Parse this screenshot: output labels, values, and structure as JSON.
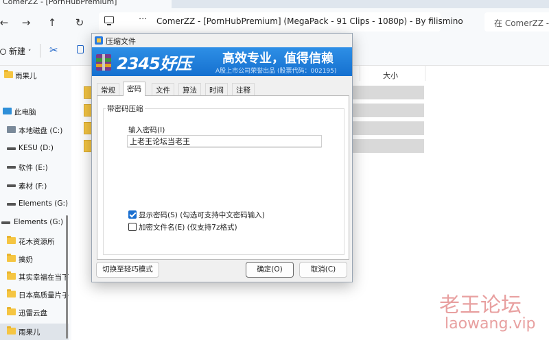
{
  "explorer": {
    "tab_title": "ComerZZ - [PornHubPremium]",
    "address_path": "ComerZZ - [PornHubPremium] (MegaPack - 91 Clips - 1080p) - By filismino",
    "address_more": "···",
    "search_placeholder": "在 ComerZZ - [P",
    "toolbar": {
      "new_label": "新建"
    },
    "column_size": "大小",
    "sidebar": [
      {
        "label": "雨果儿",
        "kind": "folder"
      },
      {
        "label": "此电脑",
        "kind": "pc"
      },
      {
        "label": "本地磁盘 (C:)",
        "kind": "local"
      },
      {
        "label": "KESU (D:)",
        "kind": "drive"
      },
      {
        "label": "软件 (E:)",
        "kind": "drive"
      },
      {
        "label": "素材 (F:)",
        "kind": "drive"
      },
      {
        "label": "Elements (G:)",
        "kind": "drive"
      },
      {
        "label": "Elements (G:)",
        "kind": "drive"
      },
      {
        "label": "花木资源所",
        "kind": "folder"
      },
      {
        "label": "擒奶",
        "kind": "folder"
      },
      {
        "label": "其实幸福在当下",
        "kind": "folder"
      },
      {
        "label": "日本高质量片子",
        "kind": "folder"
      },
      {
        "label": "迅雷云盘",
        "kind": "folder"
      },
      {
        "label": "雨果儿",
        "kind": "folder"
      }
    ]
  },
  "dialog": {
    "title": "压缩文件",
    "banner": {
      "brand": "2345好压",
      "slogan": "高效专业，值得信赖",
      "subtitle": "A股上市公司荣誉出品 (股票代码：002195)"
    },
    "tabs": [
      "常规",
      "密码",
      "文件",
      "算法",
      "时间",
      "注释"
    ],
    "active_tab": "密码",
    "group_title": "带密码压缩",
    "password_label": "输入密码(I)",
    "password_value": "上老王论坛当老王",
    "show_password": {
      "label": "显示密码(S)  (勾选可支持中文密码输入)",
      "checked": true
    },
    "encrypt_names": {
      "label": "加密文件名(E)  (仅支持7z格式)",
      "checked": false
    },
    "buttons": {
      "switch_mode": "切换至轻巧模式",
      "ok": "确定(O)",
      "cancel": "取消(C)"
    }
  },
  "watermark": {
    "line1": "老王论坛",
    "line2": "laowang.vip"
  },
  "colors": {
    "banner": "#1f7fdc",
    "folder": "#f5c542",
    "checkbox_accent": "#1a6fd0",
    "watermark": "#e8a0a0"
  }
}
